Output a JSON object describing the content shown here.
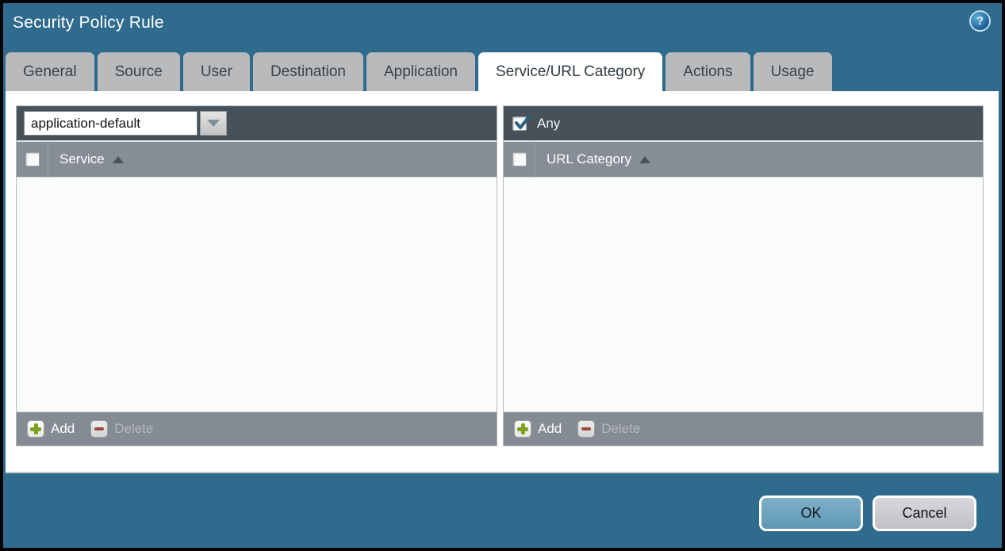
{
  "window": {
    "title": "Security Policy Rule",
    "help_icon": "?"
  },
  "tabs": [
    {
      "label": "General",
      "active": false
    },
    {
      "label": "Source",
      "active": false
    },
    {
      "label": "User",
      "active": false
    },
    {
      "label": "Destination",
      "active": false
    },
    {
      "label": "Application",
      "active": false
    },
    {
      "label": "Service/URL Category",
      "active": true
    },
    {
      "label": "Actions",
      "active": false
    },
    {
      "label": "Usage",
      "active": false
    }
  ],
  "service_panel": {
    "dropdown_value": "application-default",
    "column_header": "Service",
    "sort": "asc",
    "header_checkbox_checked": false,
    "add_label": "Add",
    "delete_label": "Delete",
    "delete_enabled": false,
    "rows": []
  },
  "url_panel": {
    "any_label": "Any",
    "any_checked": true,
    "column_header": "URL Category",
    "sort": "asc",
    "header_checkbox_checked": false,
    "add_label": "Add",
    "delete_label": "Delete",
    "delete_enabled": false,
    "rows": []
  },
  "footer": {
    "ok_label": "OK",
    "cancel_label": "Cancel"
  },
  "colors": {
    "dialog_background": "#2f6b8c",
    "toolbar_dark": "#46515a",
    "grid_header_gray": "#868d94",
    "actionbar_gray": "#848b92",
    "tab_gray": "#b9babb",
    "add_green": "#7da121",
    "delete_red": "#9c4a3c",
    "check_teal": "#2b5f7a",
    "ok_button": "#6da3bf",
    "cancel_button": "#c9c9ce"
  }
}
